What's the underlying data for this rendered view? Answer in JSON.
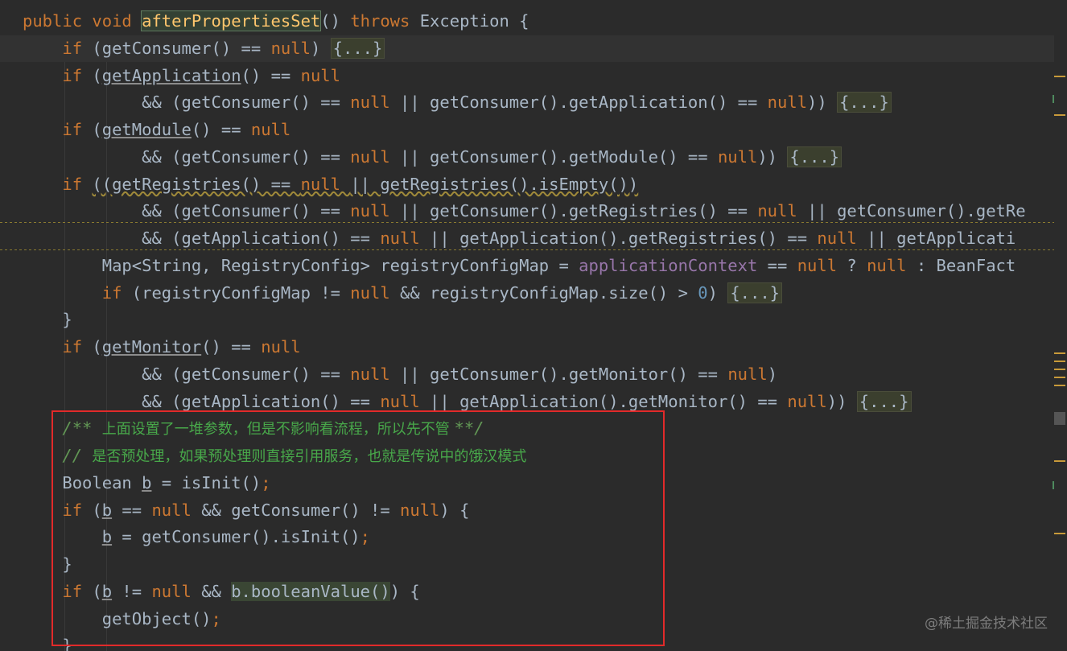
{
  "editor": {
    "lines": [
      {
        "cls": "",
        "tokens": [
          {
            "t": "public void ",
            "c": "t-kw"
          },
          {
            "t": "afterPropertiesSet",
            "c": "t-fn-decl"
          },
          {
            "t": "() ",
            "c": "t-plain"
          },
          {
            "t": "throws ",
            "c": "t-kw"
          },
          {
            "t": "Exception {",
            "c": "t-plain"
          }
        ]
      },
      {
        "cls": "current",
        "tokens": [
          {
            "t": "    if ",
            "c": "t-kw"
          },
          {
            "t": "(getConsumer() == ",
            "c": "t-plain"
          },
          {
            "t": "null",
            "c": "t-kw"
          },
          {
            "t": ") ",
            "c": "t-plain"
          },
          {
            "t": "{...}",
            "c": "t-fold"
          }
        ]
      },
      {
        "cls": "",
        "tokens": [
          {
            "t": "    if ",
            "c": "t-kw"
          },
          {
            "t": "(",
            "c": "t-plain"
          },
          {
            "t": "getApplication",
            "c": "t-plain t-under"
          },
          {
            "t": "() == ",
            "c": "t-plain"
          },
          {
            "t": "null",
            "c": "t-kw"
          }
        ]
      },
      {
        "cls": "",
        "tokens": [
          {
            "t": "            && (getConsumer() == ",
            "c": "t-plain"
          },
          {
            "t": "null ",
            "c": "t-kw"
          },
          {
            "t": "|| getConsumer().getApplication() == ",
            "c": "t-plain"
          },
          {
            "t": "null",
            "c": "t-kw"
          },
          {
            "t": ")) ",
            "c": "t-plain"
          },
          {
            "t": "{...}",
            "c": "t-fold"
          }
        ]
      },
      {
        "cls": "",
        "tokens": [
          {
            "t": "    if ",
            "c": "t-kw"
          },
          {
            "t": "(",
            "c": "t-plain"
          },
          {
            "t": "getModule",
            "c": "t-plain t-under"
          },
          {
            "t": "() == ",
            "c": "t-plain"
          },
          {
            "t": "null",
            "c": "t-kw"
          }
        ]
      },
      {
        "cls": "",
        "tokens": [
          {
            "t": "            && (getConsumer() == ",
            "c": "t-plain"
          },
          {
            "t": "null ",
            "c": "t-kw"
          },
          {
            "t": "|| getConsumer().getModule() == ",
            "c": "t-plain"
          },
          {
            "t": "null",
            "c": "t-kw"
          },
          {
            "t": ")) ",
            "c": "t-plain"
          },
          {
            "t": "{...}",
            "c": "t-fold"
          }
        ]
      },
      {
        "cls": "",
        "tokens": [
          {
            "t": "    if ",
            "c": "t-kw"
          },
          {
            "t": "((getRegistries() == ",
            "c": "t-plain t-warnul"
          },
          {
            "t": "null ",
            "c": "t-kw t-warnul"
          },
          {
            "t": "|| getRegistries().isEmpty())",
            "c": "t-plain t-warnul"
          }
        ]
      },
      {
        "cls": "warn",
        "tokens": [
          {
            "t": "            && (getConsumer() == ",
            "c": "t-plain"
          },
          {
            "t": "null ",
            "c": "t-kw"
          },
          {
            "t": "|| getConsumer().getRegistries() == ",
            "c": "t-plain"
          },
          {
            "t": "null ",
            "c": "t-kw"
          },
          {
            "t": "|| getConsumer().getRe",
            "c": "t-plain"
          }
        ]
      },
      {
        "cls": "warn",
        "tokens": [
          {
            "t": "            && (getApplication() == ",
            "c": "t-plain"
          },
          {
            "t": "null ",
            "c": "t-kw"
          },
          {
            "t": "|| getApplication().getRegistries() == ",
            "c": "t-plain"
          },
          {
            "t": "null ",
            "c": "t-kw"
          },
          {
            "t": "|| getApplicati",
            "c": "t-plain"
          }
        ]
      },
      {
        "cls": "",
        "tokens": [
          {
            "t": "        Map<String, RegistryConfig> registryConfigMap = ",
            "c": "t-plain"
          },
          {
            "t": "applicationContext ",
            "c": "t-field"
          },
          {
            "t": "== ",
            "c": "t-plain"
          },
          {
            "t": "null ",
            "c": "t-kw"
          },
          {
            "t": "? ",
            "c": "t-plain"
          },
          {
            "t": "null ",
            "c": "t-kw"
          },
          {
            "t": ": BeanFact",
            "c": "t-plain"
          }
        ]
      },
      {
        "cls": "",
        "tokens": [
          {
            "t": "        if ",
            "c": "t-kw"
          },
          {
            "t": "(registryConfigMap != ",
            "c": "t-plain"
          },
          {
            "t": "null ",
            "c": "t-kw"
          },
          {
            "t": "&& registryConfigMap.size() > ",
            "c": "t-plain"
          },
          {
            "t": "0",
            "c": "t-num"
          },
          {
            "t": ") ",
            "c": "t-plain"
          },
          {
            "t": "{...}",
            "c": "t-fold"
          }
        ]
      },
      {
        "cls": "",
        "tokens": [
          {
            "t": "    }",
            "c": "t-plain"
          }
        ]
      },
      {
        "cls": "",
        "tokens": [
          {
            "t": "    if ",
            "c": "t-kw"
          },
          {
            "t": "(",
            "c": "t-plain"
          },
          {
            "t": "getMonitor",
            "c": "t-plain t-under"
          },
          {
            "t": "() == ",
            "c": "t-plain"
          },
          {
            "t": "null",
            "c": "t-kw"
          }
        ]
      },
      {
        "cls": "",
        "tokens": [
          {
            "t": "            && (getConsumer() == ",
            "c": "t-plain"
          },
          {
            "t": "null ",
            "c": "t-kw"
          },
          {
            "t": "|| getConsumer().getMonitor() == ",
            "c": "t-plain"
          },
          {
            "t": "null",
            "c": "t-kw"
          },
          {
            "t": ")",
            "c": "t-plain"
          }
        ]
      },
      {
        "cls": "",
        "tokens": [
          {
            "t": "            && (getApplication() == ",
            "c": "t-plain"
          },
          {
            "t": "null ",
            "c": "t-kw"
          },
          {
            "t": "|| getApplication().getMonitor() == ",
            "c": "t-plain"
          },
          {
            "t": "null",
            "c": "t-kw"
          },
          {
            "t": ")) ",
            "c": "t-plain"
          },
          {
            "t": "{...}",
            "c": "t-fold"
          }
        ]
      },
      {
        "cls": "",
        "tokens": [
          {
            "t": "    /** ",
            "c": "t-com"
          },
          {
            "t": "上面设置了一堆参数，但是不影响看流程，所以先不管 ",
            "c": "t-cn"
          },
          {
            "t": "**/",
            "c": "t-com"
          }
        ]
      },
      {
        "cls": "",
        "tokens": [
          {
            "t": "    // ",
            "c": "t-com"
          },
          {
            "t": "是否预处理，如果预处理则直接引用服务，也就是传说中的饿汉模式",
            "c": "t-cn"
          }
        ]
      },
      {
        "cls": "",
        "tokens": [
          {
            "t": "    Boolean ",
            "c": "t-plain"
          },
          {
            "t": "b",
            "c": "t-plain t-under"
          },
          {
            "t": " = isInit()",
            "c": "t-plain"
          },
          {
            "t": ";",
            "c": "t-kw"
          }
        ]
      },
      {
        "cls": "",
        "tokens": [
          {
            "t": "    if ",
            "c": "t-kw"
          },
          {
            "t": "(",
            "c": "t-plain"
          },
          {
            "t": "b",
            "c": "t-plain t-under"
          },
          {
            "t": " == ",
            "c": "t-plain"
          },
          {
            "t": "null ",
            "c": "t-kw"
          },
          {
            "t": "&& getConsumer() != ",
            "c": "t-plain"
          },
          {
            "t": "null",
            "c": "t-kw"
          },
          {
            "t": ") {",
            "c": "t-plain"
          }
        ]
      },
      {
        "cls": "",
        "tokens": [
          {
            "t": "        ",
            "c": "t-plain"
          },
          {
            "t": "b",
            "c": "t-plain t-under"
          },
          {
            "t": " = getConsumer().isInit()",
            "c": "t-plain"
          },
          {
            "t": ";",
            "c": "t-kw"
          }
        ]
      },
      {
        "cls": "",
        "tokens": [
          {
            "t": "    }",
            "c": "t-plain"
          }
        ]
      },
      {
        "cls": "",
        "tokens": [
          {
            "t": "    if ",
            "c": "t-kw"
          },
          {
            "t": "(",
            "c": "t-plain"
          },
          {
            "t": "b",
            "c": "t-plain t-under"
          },
          {
            "t": " != ",
            "c": "t-plain"
          },
          {
            "t": "null ",
            "c": "t-kw"
          },
          {
            "t": "&& ",
            "c": "t-plain"
          },
          {
            "t": "b.booleanValue()",
            "c": "t-plain t-hl"
          },
          {
            "t": ") {",
            "c": "t-plain"
          }
        ]
      },
      {
        "cls": "",
        "tokens": [
          {
            "t": "        getObject()",
            "c": "t-plain"
          },
          {
            "t": ";",
            "c": "t-kw"
          }
        ]
      },
      {
        "cls": "",
        "tokens": [
          {
            "t": "    }",
            "c": "t-plain"
          }
        ]
      }
    ]
  },
  "colors": {
    "background": "#2b2b2b",
    "keyword": "#cc7832",
    "text": "#a9b7c6",
    "comment": "#629755",
    "highlight_box": "#e22a2a"
  },
  "watermark": "@稀土掘金技术社区"
}
